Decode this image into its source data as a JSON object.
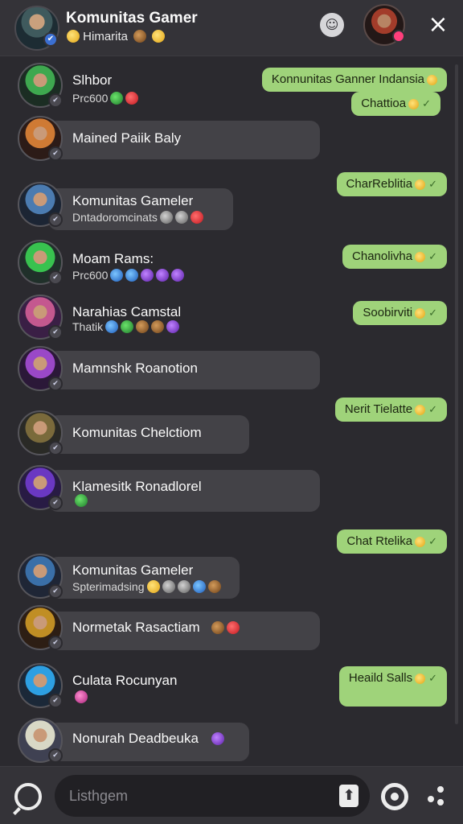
{
  "header": {
    "title": "Komunitas Gamer",
    "subtitle": "Himarita",
    "close_icon": "×",
    "chat_icon": "☺"
  },
  "incoming": [
    {
      "name": "Slhbor",
      "sub": "Prc600",
      "emojis": [
        "green",
        "red"
      ]
    },
    {
      "name": "Mained Paiik Baly",
      "sub": "",
      "emojis": []
    },
    {
      "name": "Komunitas Gameler",
      "sub": "Dntadoromcinats",
      "emojis": [
        "gray",
        "gray",
        "red"
      ]
    },
    {
      "name": "Moam Rams:",
      "sub": "Prc600",
      "emojis": [
        "blue",
        "blue",
        "purple",
        "purple",
        "purple"
      ]
    },
    {
      "name": "Narahias Camstal",
      "sub": "Thatik",
      "emojis": [
        "blue",
        "green",
        "brown",
        "brown",
        "purple"
      ]
    },
    {
      "name": "Mamnshk Roanotion",
      "sub": "",
      "emojis": []
    },
    {
      "name": "Komunitas Chelctiom",
      "sub": "",
      "emojis": []
    },
    {
      "name": "Klamesitk Ronadlorel",
      "sub": "",
      "emojis": [
        "green"
      ]
    },
    {
      "name": "Komunitas Gameler",
      "sub": "Spterimadsing",
      "emojis": [
        "yellow",
        "gray",
        "gray",
        "blue",
        "brown"
      ]
    },
    {
      "name": "Normetak Rasactiam",
      "sub": "",
      "emojis": [
        "brown",
        "red"
      ]
    },
    {
      "name": "Culata Rocunyan",
      "sub": "",
      "emojis": [
        "pink"
      ]
    },
    {
      "name": "Nonurah Deadbeuka",
      "sub": "",
      "emojis": [
        "purple"
      ]
    }
  ],
  "outgoing": [
    {
      "text": "Konnunitas Ganner Indansia",
      "check": false
    },
    {
      "text": "Chattioa",
      "check": true
    },
    {
      "text": "CharReblitia",
      "check": true
    },
    {
      "text": "Chanolivha",
      "check": true
    },
    {
      "text": "Soobirviti",
      "check": true
    },
    {
      "text": "Nerit Tielatte",
      "check": true
    },
    {
      "text": "Chat Rtelika",
      "check": true
    },
    {
      "text": "Heaild Salls",
      "check": true
    }
  ],
  "input": {
    "placeholder": "Listhgem"
  },
  "icons": {
    "check": "✓",
    "upload": "⬆",
    "badge": "✔"
  }
}
